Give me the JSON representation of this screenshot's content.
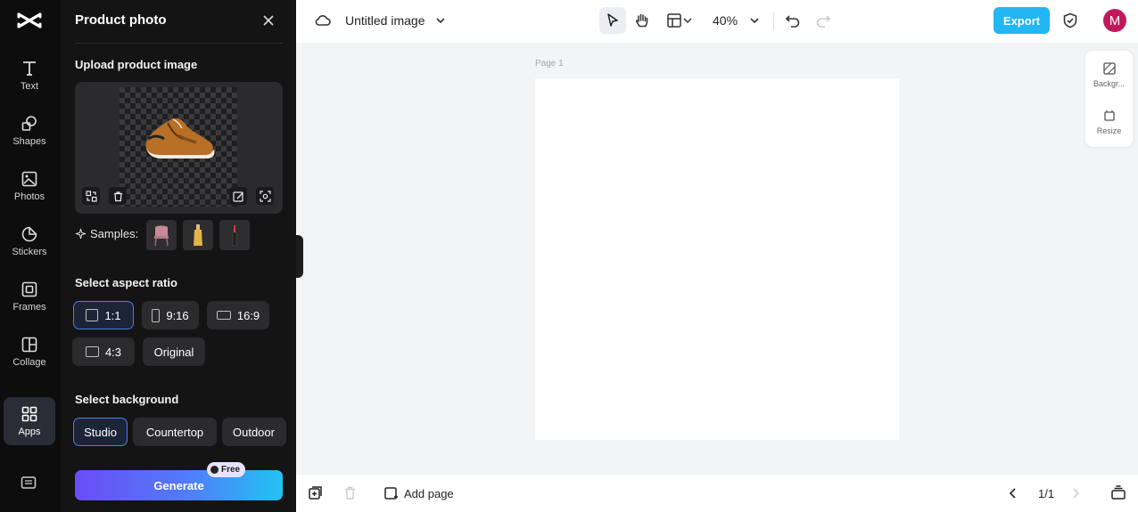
{
  "rail": {
    "items": [
      {
        "label": "Text",
        "icon": "text-icon"
      },
      {
        "label": "Shapes",
        "icon": "shapes-icon"
      },
      {
        "label": "Photos",
        "icon": "photos-icon"
      },
      {
        "label": "Stickers",
        "icon": "stickers-icon"
      },
      {
        "label": "Frames",
        "icon": "frames-icon"
      },
      {
        "label": "Collage",
        "icon": "collage-icon"
      },
      {
        "label": "Apps",
        "icon": "apps-icon",
        "active": true
      }
    ]
  },
  "panel": {
    "title": "Product photo",
    "upload_label": "Upload product image",
    "samples_label": "Samples:",
    "aspect_label": "Select aspect ratio",
    "aspect_options": [
      "1:1",
      "9:16",
      "16:9",
      "4:3",
      "Original"
    ],
    "aspect_selected": "1:1",
    "background_label": "Select background",
    "background_options": [
      "Studio",
      "Countertop",
      "Outdoor"
    ],
    "background_selected": "Studio",
    "generate_label": "Generate",
    "free_badge": "Free"
  },
  "topbar": {
    "doc_title": "Untitled image",
    "zoom": "40%",
    "export_label": "Export",
    "avatar_initial": "M"
  },
  "canvas": {
    "page_label": "Page 1"
  },
  "right_tools": [
    {
      "label": "Backgr...",
      "icon": "background-icon"
    },
    {
      "label": "Resize",
      "icon": "resize-icon"
    }
  ],
  "bottombar": {
    "add_page_label": "Add page",
    "page_count": "1/1"
  },
  "colors": {
    "accent": "#22b6f2",
    "selected_border": "#4b7bf5",
    "avatar": "#c2185b"
  }
}
